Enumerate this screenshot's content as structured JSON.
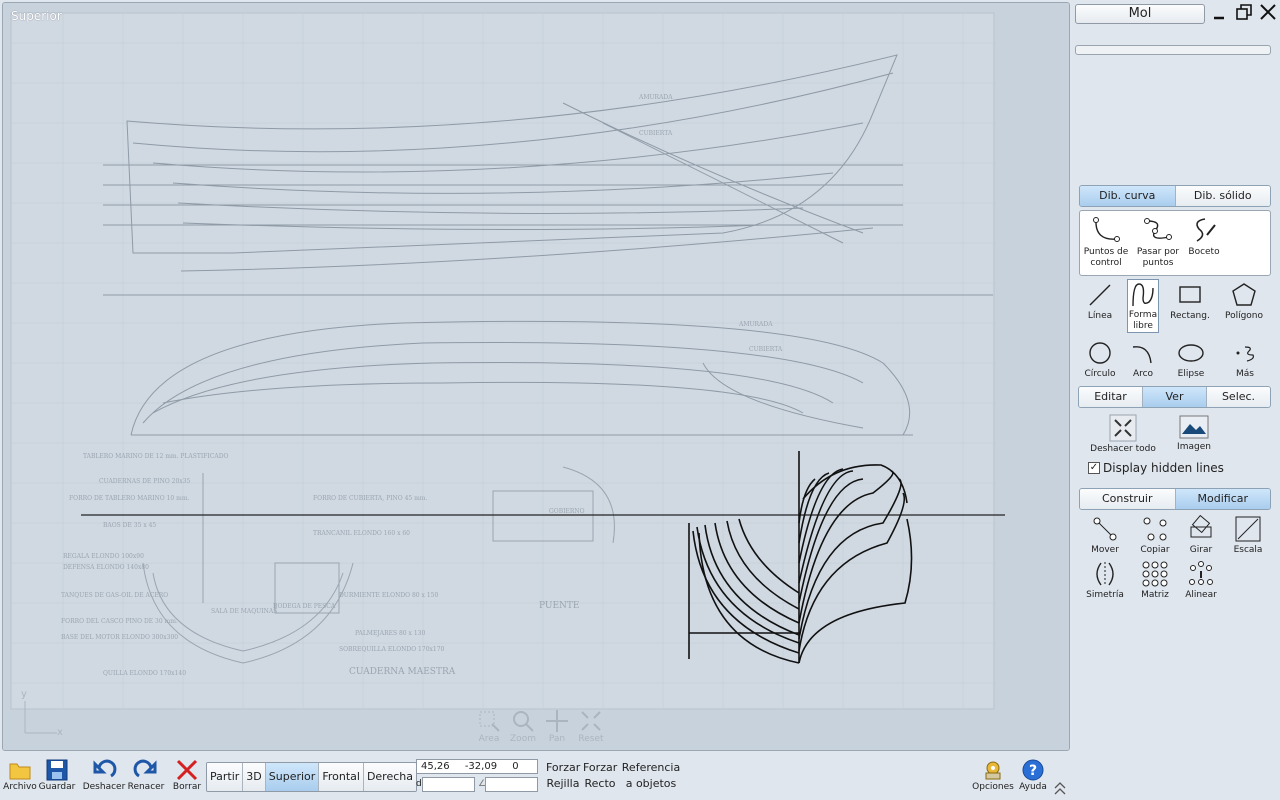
{
  "viewport": {
    "title": "Superior",
    "axis_y": "y",
    "axis_x": "x",
    "nav_tools": [
      {
        "label": "Area",
        "icon": "zoom-area-icon"
      },
      {
        "label": "Zoom",
        "icon": "zoom-icon"
      },
      {
        "label": "Pan",
        "icon": "pan-icon"
      },
      {
        "label": "Reset",
        "icon": "reset-icon"
      }
    ],
    "blueprint_labels": [
      "AMURADA",
      "CUBIERTA",
      "AMURADA",
      "CUBIERTA",
      "PUENTE",
      "CUADERNA MAESTRA",
      "GOBIERNO",
      "SALA DE MAQUINAS",
      "BODEGA DE PESCA",
      "TABLERO MARINO DE 12 mm. PLASTIFICADO",
      "CUADERNAS DE PINO 20x35",
      "FORRO DE TABLERO MARINO 10 mm.",
      "BAOS DE 35 x 45",
      "FORRO DE CUBIERTA, PINO 45 mm.",
      "TRANCANIL ELONDO 160 x 60",
      "REGALA ELONDO 100x90",
      "DEFENSA ELONDO 140x80",
      "TANQUES DE GAS-OIL DE ACERO",
      "FORRO DEL CASCO PINO DE 30 mm.",
      "BASE DEL MOTOR ELONDO 300x300",
      "QUILLA ELONDO 170x140",
      "DURMIENTE ELONDO 80 x 150",
      "PALMEJARES 80 x 130",
      "SOBREQUILLA ELONDO 170x170"
    ]
  },
  "panel": {
    "doc_name": "Mol",
    "draw_tabs": [
      {
        "label": "Dib. curva",
        "active": true
      },
      {
        "label": "Dib. sólido",
        "active": false
      }
    ],
    "curve_tools": [
      {
        "label": "Puntos de control",
        "icon": "control-points-icon"
      },
      {
        "label": "Pasar por puntos",
        "icon": "through-points-icon"
      },
      {
        "label": "Boceto",
        "icon": "sketch-icon"
      }
    ],
    "shape_tools": [
      {
        "label": "Línea",
        "icon": "line-icon"
      },
      {
        "label": "Forma libre",
        "icon": "freeform-icon"
      },
      {
        "label": "Rectang.",
        "icon": "rectangle-icon"
      },
      {
        "label": "Polígono",
        "icon": "polygon-icon"
      },
      {
        "label": "Círculo",
        "icon": "circle-icon"
      },
      {
        "label": "Arco",
        "icon": "arc-icon"
      },
      {
        "label": "Elipse",
        "icon": "ellipse-icon"
      },
      {
        "label": "Más",
        "icon": "more-icon"
      }
    ],
    "view_tabs": [
      {
        "label": "Editar",
        "active": false
      },
      {
        "label": "Ver",
        "active": true
      },
      {
        "label": "Selec.",
        "active": false
      }
    ],
    "view_tools": [
      {
        "label": "Deshacer todo",
        "icon": "undo-all-icon"
      },
      {
        "label": "Imagen",
        "icon": "image-icon"
      }
    ],
    "hidden_lines": {
      "label": "Display hidden lines",
      "checked": true
    },
    "edit_tabs": [
      {
        "label": "Construir",
        "active": false
      },
      {
        "label": "Modificar",
        "active": true
      }
    ],
    "modify_tools": [
      {
        "label": "Mover",
        "icon": "move-icon"
      },
      {
        "label": "Copiar",
        "icon": "copy-icon"
      },
      {
        "label": "Girar",
        "icon": "rotate-icon"
      },
      {
        "label": "Escala",
        "icon": "scale-icon"
      },
      {
        "label": "Simetría",
        "icon": "mirror-icon"
      },
      {
        "label": "Matriz",
        "icon": "array-icon"
      },
      {
        "label": "Alinear",
        "icon": "align-icon"
      }
    ]
  },
  "bottom": {
    "file_tools": [
      {
        "label": "Archivo",
        "icon": "folder-icon"
      },
      {
        "label": "Guardar",
        "icon": "save-icon"
      },
      {
        "label": "Deshacer",
        "icon": "undo-icon"
      },
      {
        "label": "Renacer",
        "icon": "redo-icon"
      },
      {
        "label": "Borrar",
        "icon": "delete-icon"
      }
    ],
    "view_buttons": [
      {
        "label": "Partir",
        "active": false
      },
      {
        "label": "3D",
        "active": false
      },
      {
        "label": "Superior",
        "active": true
      },
      {
        "label": "Frontal",
        "active": false
      },
      {
        "label": "Derecha",
        "active": false
      }
    ],
    "coords": {
      "x": "45,26",
      "y": "-32,09",
      "z": "0",
      "dist_prefix": "d",
      "angle_prefix": "∠",
      "dist": "",
      "angle": ""
    },
    "snap": {
      "grid_1": "Forzar",
      "grid_2": "Rejilla",
      "straight_1": "Forzar",
      "straight_2": "Recto",
      "ref_1": "Referencia",
      "ref_2": "a objetos"
    },
    "right_tools": [
      {
        "label": "Opciones",
        "icon": "options-icon"
      },
      {
        "label": "Ayuda",
        "icon": "help-icon"
      }
    ]
  },
  "colors": {
    "accent": "#a9cdee",
    "paper": "#cdd6df",
    "curve": "#111111"
  }
}
